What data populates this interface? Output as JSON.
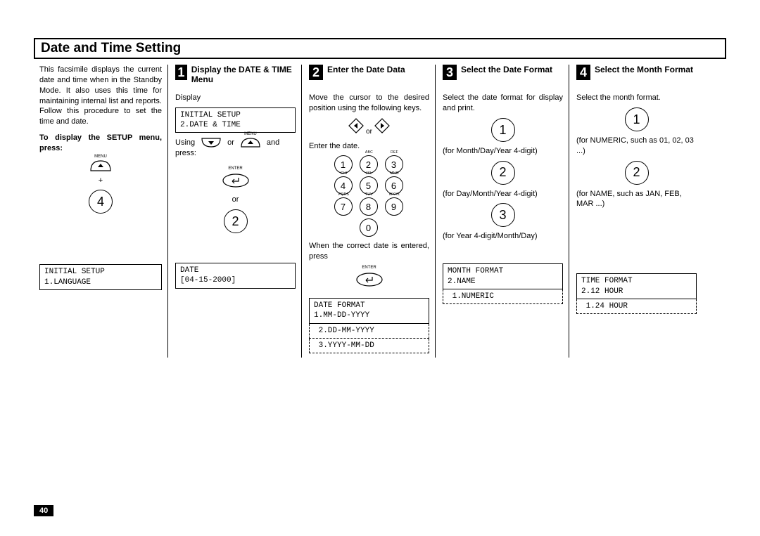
{
  "page_number": "40",
  "title": "Date and Time Setting",
  "intro": {
    "paragraph": "This facsimile displays the current date and time when in the Standby Mode. It also uses this time for maintaining internal list and reports. Follow this procedure to set the time and date.",
    "setup_instruction": "To display the SETUP menu, press:",
    "menu_label": "MENU",
    "plus": "+",
    "key4": "4",
    "lcd": "INITIAL SETUP\n1.LANGUAGE"
  },
  "step1": {
    "num": "1",
    "title": "Display the DATE & TIME Menu",
    "display_label": "Display",
    "lcd1": "INITIAL SETUP\n2.DATE & TIME",
    "using": "Using",
    "or": "or",
    "and": "and",
    "press": "press:",
    "menu_label": "MENU",
    "enter_label": "ENTER",
    "or2": "or",
    "key2": "2",
    "lcd2": "DATE\n[04-15-2000]"
  },
  "step2": {
    "num": "2",
    "title": "Enter the Date Data",
    "para1": "Move the cursor to the desired position using the following keys.",
    "or": "or",
    "para2": "Enter the date.",
    "keypad": [
      "1",
      "2",
      "3",
      "4",
      "5",
      "6",
      "7",
      "8",
      "9",
      "0"
    ],
    "keypad_labels": [
      "",
      "ABC",
      "DEF",
      "GHI",
      "JKL",
      "MNO",
      "PQRS",
      "TUV",
      "WXYZ",
      ""
    ],
    "para3": "When the correct date is entered, press",
    "enter_label": "ENTER",
    "lcd": "DATE FORMAT\n1.MM-DD-YYYY",
    "lcd_opt2": " 2.DD-MM-YYYY",
    "lcd_opt3": " 3.YYYY-MM-DD"
  },
  "step3": {
    "num": "3",
    "title": "Select the Date Format",
    "para": "Select the date format for display and print.",
    "opt1": {
      "key": "1",
      "text": "(for Month/Day/Year 4-digit)"
    },
    "opt2": {
      "key": "2",
      "text": "(for Day/Month/Year 4-digit)"
    },
    "opt3": {
      "key": "3",
      "text": "(for Year 4-digit/Month/Day)"
    },
    "lcd": "MONTH FORMAT\n2.NAME",
    "lcd_opt": " 1.NUMERIC"
  },
  "step4": {
    "num": "4",
    "title": "Select the Month Format",
    "para": "Select the month format.",
    "opt1": {
      "key": "1",
      "text": "(for NUMERIC, such as 01, 02, 03 ...)"
    },
    "opt2": {
      "key": "2",
      "text": "(for NAME, such as JAN, FEB, MAR ...)"
    },
    "lcd": "TIME FORMAT\n2.12 HOUR",
    "lcd_opt": " 1.24 HOUR"
  }
}
